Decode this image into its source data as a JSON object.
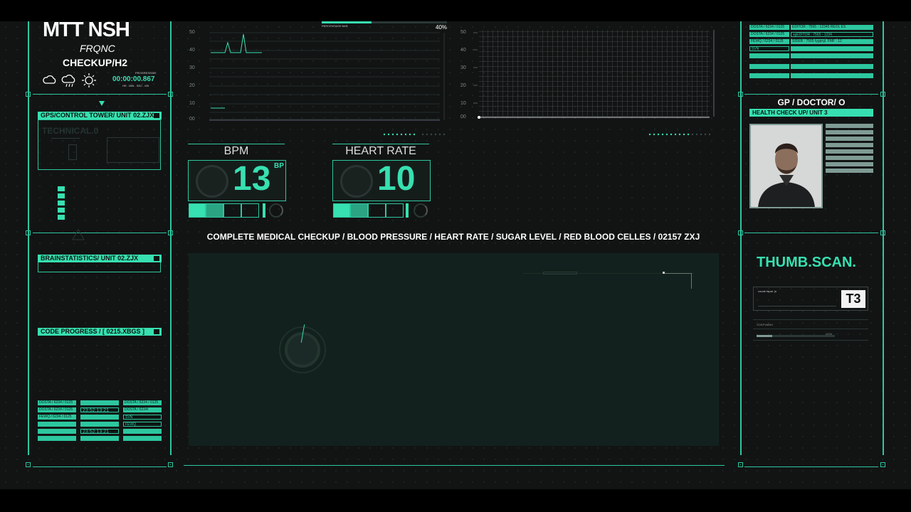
{
  "header": {
    "title": "MTT NSH",
    "subtitle": "FRQNC",
    "checkup": "CHECKUP/H2",
    "timer": "00:00:00.867",
    "timer_sub": "HR . MIN . SEC . MS",
    "timer_head": "PROGRESS000"
  },
  "weather_icons": [
    "cloud-icon",
    "rain-cloud-icon",
    "sun-icon"
  ],
  "left_panel": {
    "gps_label": "GPS/CONTROL TOWER/ UNIT 02.ZJX",
    "technical": "TECHNICAL.0",
    "brain_label": "BRAINSTATISTICS/ UNIT 02.ZJX",
    "code_label": "CODE PROGRESS / [ 0215.XBGS ]",
    "table": {
      "col1": [
        "DOSTA / 6234 / 0125",
        "DOSTA / 6234 / 0125",
        "FEWQ / 6234 / 0125",
        "",
        "",
        ""
      ],
      "col2": [
        "",
        "23:52:13:21",
        "",
        "",
        "23:52:13:21",
        ""
      ],
      "col3": [
        "DOSTA / 6234 / 0125",
        "DOSTA / 6234/",
        "SVN",
        "FEWQ",
        "",
        ""
      ]
    }
  },
  "top_chart": {
    "label": "PERCENTAGE BAR",
    "percent": "40%",
    "y_ticks": [
      "50",
      "40",
      "30",
      "20",
      "10",
      "00"
    ]
  },
  "grid_chart": {
    "y_ticks": [
      "50",
      "40",
      "30",
      "20",
      "10",
      "00"
    ]
  },
  "stats": {
    "bpm": {
      "title": "BPM",
      "value": "13",
      "unit": "BP",
      "level": 0.4
    },
    "heart_rate": {
      "title": "HEART RATE",
      "value": "10",
      "level": 0.4
    }
  },
  "banner": "COMPLETE MEDICAL CHECKUP / BLOOD PRESSURE / HEART RATE / SUGAR LEVEL / RED BLOOD CELLES / 02157 ZXJ",
  "right_panel": {
    "table": {
      "col1": [
        "DOSTA / 6234 / 0125",
        "DOSTA / 6234 / 0125",
        "FEWQ / 6234 / 0125",
        "SVN",
        "",
        "",
        ""
      ],
      "col2": [
        "EDITOR : 7565 - 12345 REOL ES",
        "sgEDITOR : 7565 - 1234",
        "SIDER : 7565 tygprgl. FMF : 12",
        "",
        "",
        "",
        ""
      ]
    },
    "doctor_title": "GP / DOCTOR/ O",
    "health_label": "HEALTH CHECK UP/ UNIT 3",
    "thumb_title": "THUMB.SCAN.",
    "thumb_caption": "coude fapal. jn",
    "thumb_badge": "T3",
    "thumb_field": "VODFVABIH",
    "thumb_small": "1234"
  },
  "colors": {
    "accent": "#37e0b0",
    "line": "#2dc79f",
    "background": "#121414"
  }
}
